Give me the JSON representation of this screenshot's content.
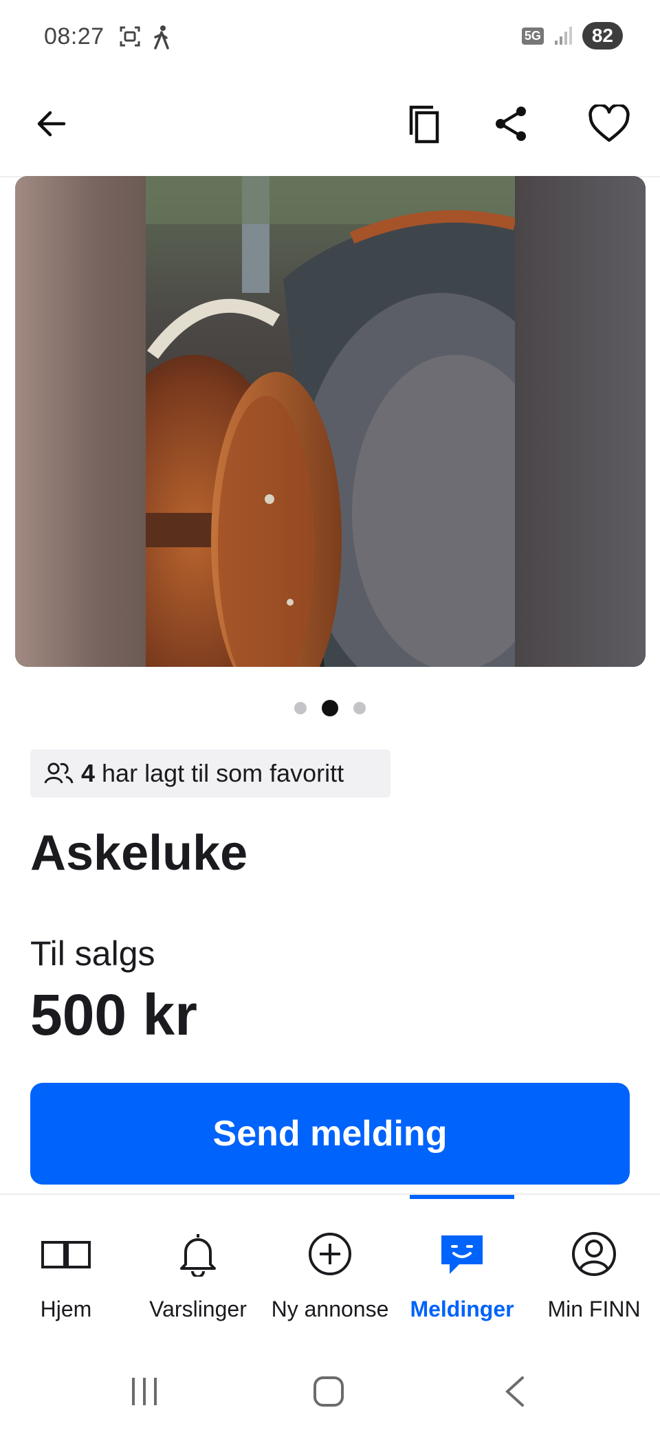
{
  "status_bar": {
    "time": "08:27",
    "network": "5G",
    "battery": "82"
  },
  "listing": {
    "gallery": {
      "image_count": 3,
      "active_index": 1
    },
    "favorites": {
      "count": "4",
      "text": "har lagt til som favoritt"
    },
    "title": "Askeluke",
    "sale_type": "Til salgs",
    "price": "500 kr",
    "cta_label": "Send melding"
  },
  "bottom_nav": {
    "items": [
      {
        "label": "Hjem",
        "icon": "book-icon"
      },
      {
        "label": "Varslinger",
        "icon": "bell-icon"
      },
      {
        "label": "Ny annonse",
        "icon": "plus-circle-icon"
      },
      {
        "label": "Meldinger",
        "icon": "chat-icon",
        "active": true
      },
      {
        "label": "Min FINN",
        "icon": "profile-icon"
      }
    ]
  },
  "colors": {
    "accent": "#0063fb",
    "text": "#1b1b1f",
    "badge_bg": "#f1f1f4"
  }
}
